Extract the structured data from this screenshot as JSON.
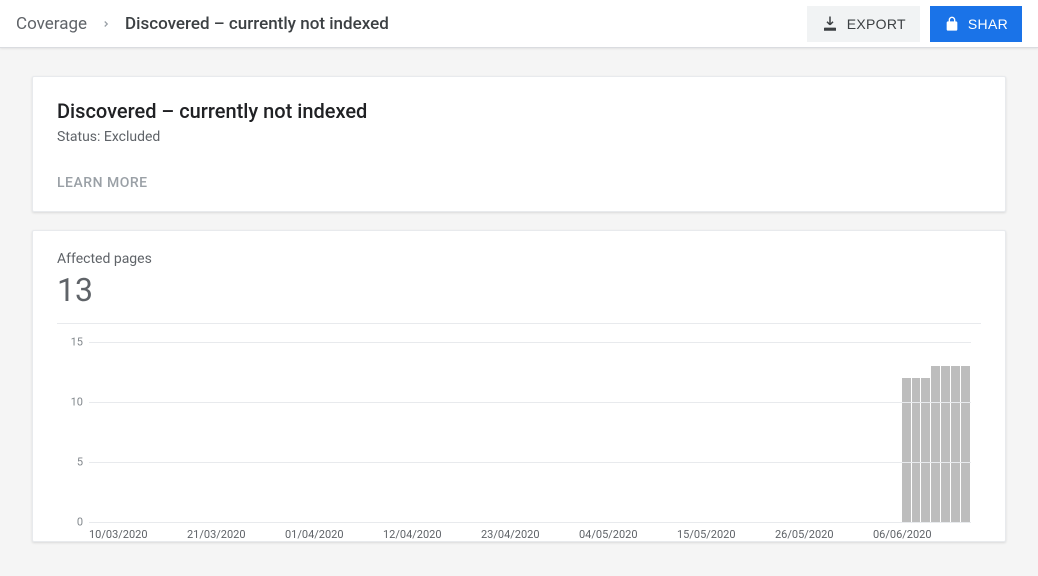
{
  "topbar": {
    "breadcrumb_root": "Coverage",
    "breadcrumb_current": "Discovered – currently not indexed",
    "export_label": "EXPORT",
    "share_label": "SHAR"
  },
  "card1": {
    "title": "Discovered – currently not indexed",
    "status": "Status: Excluded",
    "learn_more": "LEARN MORE"
  },
  "card2": {
    "metric_label": "Affected pages",
    "metric_value": "13"
  },
  "chart_data": {
    "type": "bar",
    "title": "",
    "xlabel": "",
    "ylabel": "",
    "ylim": [
      0,
      15
    ],
    "yticks": [
      0,
      5,
      10,
      15
    ],
    "xticks": [
      "10/03/2020",
      "21/03/2020",
      "01/04/2020",
      "12/04/2020",
      "23/04/2020",
      "04/05/2020",
      "15/05/2020",
      "26/05/2020",
      "06/06/2020"
    ],
    "categories": [
      "10/03/2020",
      "11/03/2020",
      "12/03/2020",
      "13/03/2020",
      "14/03/2020",
      "15/03/2020",
      "16/03/2020",
      "17/03/2020",
      "18/03/2020",
      "19/03/2020",
      "20/03/2020",
      "21/03/2020",
      "22/03/2020",
      "23/03/2020",
      "24/03/2020",
      "25/03/2020",
      "26/03/2020",
      "27/03/2020",
      "28/03/2020",
      "29/03/2020",
      "30/03/2020",
      "31/03/2020",
      "01/04/2020",
      "02/04/2020",
      "03/04/2020",
      "04/04/2020",
      "05/04/2020",
      "06/04/2020",
      "07/04/2020",
      "08/04/2020",
      "09/04/2020",
      "10/04/2020",
      "11/04/2020",
      "12/04/2020",
      "13/04/2020",
      "14/04/2020",
      "15/04/2020",
      "16/04/2020",
      "17/04/2020",
      "18/04/2020",
      "19/04/2020",
      "20/04/2020",
      "21/04/2020",
      "22/04/2020",
      "23/04/2020",
      "24/04/2020",
      "25/04/2020",
      "26/04/2020",
      "27/04/2020",
      "28/04/2020",
      "29/04/2020",
      "30/04/2020",
      "01/05/2020",
      "02/05/2020",
      "03/05/2020",
      "04/05/2020",
      "05/05/2020",
      "06/05/2020",
      "07/05/2020",
      "08/05/2020",
      "09/05/2020",
      "10/05/2020",
      "11/05/2020",
      "12/05/2020",
      "13/05/2020",
      "14/05/2020",
      "15/05/2020",
      "16/05/2020",
      "17/05/2020",
      "18/05/2020",
      "19/05/2020",
      "20/05/2020",
      "21/05/2020",
      "22/05/2020",
      "23/05/2020",
      "24/05/2020",
      "25/05/2020",
      "26/05/2020",
      "27/05/2020",
      "28/05/2020",
      "29/05/2020",
      "30/05/2020",
      "31/05/2020",
      "01/06/2020",
      "02/06/2020",
      "03/06/2020",
      "04/06/2020",
      "05/06/2020",
      "06/06/2020"
    ],
    "values": [
      0,
      0,
      0,
      0,
      0,
      0,
      0,
      0,
      0,
      0,
      0,
      0,
      0,
      0,
      0,
      0,
      0,
      0,
      0,
      0,
      0,
      0,
      0,
      0,
      0,
      0,
      0,
      0,
      0,
      0,
      0,
      0,
      0,
      0,
      0,
      0,
      0,
      0,
      0,
      0,
      0,
      0,
      0,
      0,
      0,
      0,
      0,
      0,
      0,
      0,
      0,
      0,
      0,
      0,
      0,
      0,
      0,
      0,
      0,
      0,
      0,
      0,
      0,
      0,
      0,
      0,
      0,
      0,
      0,
      0,
      0,
      0,
      0,
      0,
      0,
      0,
      0,
      0,
      0,
      0,
      0,
      0,
      12,
      12,
      12,
      13,
      13,
      13,
      13
    ]
  }
}
